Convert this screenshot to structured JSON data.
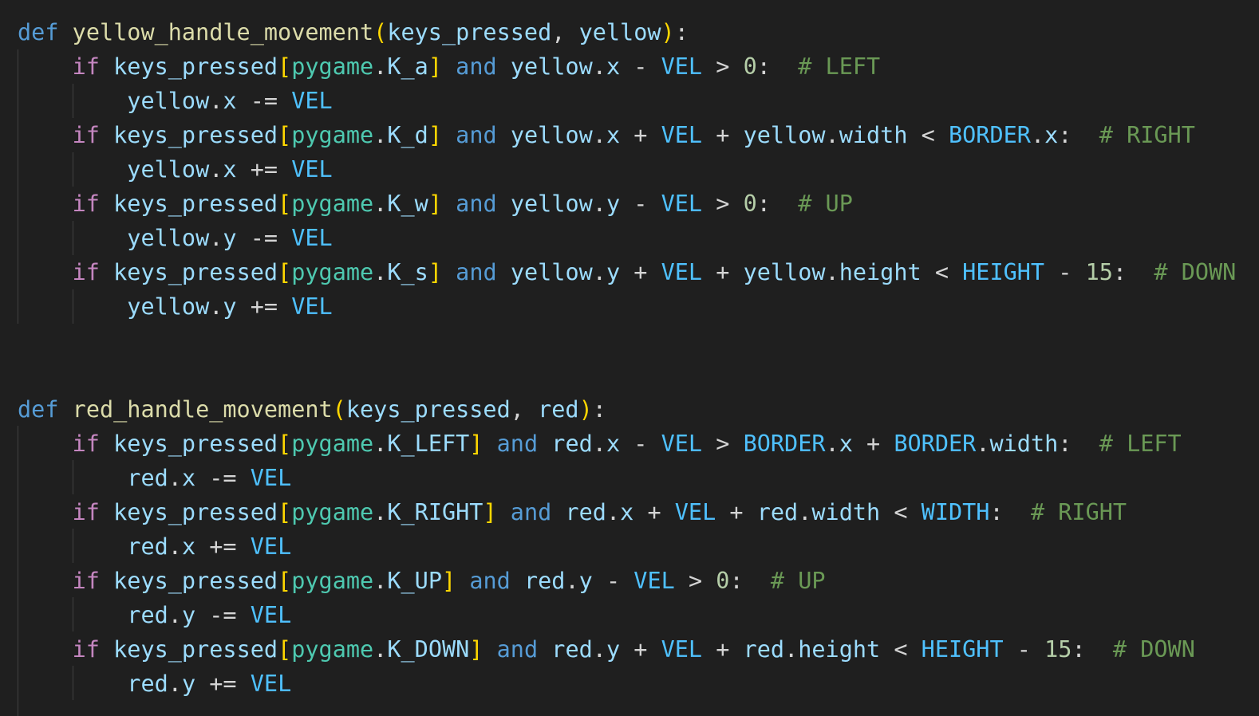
{
  "editor": {
    "lines": [
      [
        [
          "kw",
          "def"
        ],
        [
          "op",
          " "
        ],
        [
          "fn",
          "yellow_handle_movement"
        ],
        [
          "br",
          "("
        ],
        [
          "param",
          "keys_pressed"
        ],
        [
          "op",
          ", "
        ],
        [
          "param",
          "yellow"
        ],
        [
          "br",
          ")"
        ],
        [
          "op",
          ":"
        ]
      ],
      [
        [
          "op",
          "    "
        ],
        [
          "ctrl",
          "if"
        ],
        [
          "op",
          " "
        ],
        [
          "param",
          "keys_pressed"
        ],
        [
          "br",
          "["
        ],
        [
          "mod",
          "pygame"
        ],
        [
          "op",
          "."
        ],
        [
          "param",
          "K_a"
        ],
        [
          "br",
          "]"
        ],
        [
          "op",
          " "
        ],
        [
          "kw",
          "and"
        ],
        [
          "op",
          " "
        ],
        [
          "param",
          "yellow"
        ],
        [
          "op",
          "."
        ],
        [
          "param",
          "x"
        ],
        [
          "op",
          " - "
        ],
        [
          "const",
          "VEL"
        ],
        [
          "op",
          " > "
        ],
        [
          "num",
          "0"
        ],
        [
          "op",
          ":  "
        ],
        [
          "cmt",
          "# LEFT"
        ]
      ],
      [
        [
          "op",
          "        "
        ],
        [
          "param",
          "yellow"
        ],
        [
          "op",
          "."
        ],
        [
          "param",
          "x"
        ],
        [
          "op",
          " -= "
        ],
        [
          "const",
          "VEL"
        ]
      ],
      [
        [
          "op",
          "    "
        ],
        [
          "ctrl",
          "if"
        ],
        [
          "op",
          " "
        ],
        [
          "param",
          "keys_pressed"
        ],
        [
          "br",
          "["
        ],
        [
          "mod",
          "pygame"
        ],
        [
          "op",
          "."
        ],
        [
          "param",
          "K_d"
        ],
        [
          "br",
          "]"
        ],
        [
          "op",
          " "
        ],
        [
          "kw",
          "and"
        ],
        [
          "op",
          " "
        ],
        [
          "param",
          "yellow"
        ],
        [
          "op",
          "."
        ],
        [
          "param",
          "x"
        ],
        [
          "op",
          " + "
        ],
        [
          "const",
          "VEL"
        ],
        [
          "op",
          " + "
        ],
        [
          "param",
          "yellow"
        ],
        [
          "op",
          "."
        ],
        [
          "param",
          "width"
        ],
        [
          "op",
          " < "
        ],
        [
          "const",
          "BORDER"
        ],
        [
          "op",
          "."
        ],
        [
          "param",
          "x"
        ],
        [
          "op",
          ":  "
        ],
        [
          "cmt",
          "# RIGHT"
        ]
      ],
      [
        [
          "op",
          "        "
        ],
        [
          "param",
          "yellow"
        ],
        [
          "op",
          "."
        ],
        [
          "param",
          "x"
        ],
        [
          "op",
          " += "
        ],
        [
          "const",
          "VEL"
        ]
      ],
      [
        [
          "op",
          "    "
        ],
        [
          "ctrl",
          "if"
        ],
        [
          "op",
          " "
        ],
        [
          "param",
          "keys_pressed"
        ],
        [
          "br",
          "["
        ],
        [
          "mod",
          "pygame"
        ],
        [
          "op",
          "."
        ],
        [
          "param",
          "K_w"
        ],
        [
          "br",
          "]"
        ],
        [
          "op",
          " "
        ],
        [
          "kw",
          "and"
        ],
        [
          "op",
          " "
        ],
        [
          "param",
          "yellow"
        ],
        [
          "op",
          "."
        ],
        [
          "param",
          "y"
        ],
        [
          "op",
          " - "
        ],
        [
          "const",
          "VEL"
        ],
        [
          "op",
          " > "
        ],
        [
          "num",
          "0"
        ],
        [
          "op",
          ":  "
        ],
        [
          "cmt",
          "# UP"
        ]
      ],
      [
        [
          "op",
          "        "
        ],
        [
          "param",
          "yellow"
        ],
        [
          "op",
          "."
        ],
        [
          "param",
          "y"
        ],
        [
          "op",
          " -= "
        ],
        [
          "const",
          "VEL"
        ]
      ],
      [
        [
          "op",
          "    "
        ],
        [
          "ctrl",
          "if"
        ],
        [
          "op",
          " "
        ],
        [
          "param",
          "keys_pressed"
        ],
        [
          "br",
          "["
        ],
        [
          "mod",
          "pygame"
        ],
        [
          "op",
          "."
        ],
        [
          "param",
          "K_s"
        ],
        [
          "br",
          "]"
        ],
        [
          "op",
          " "
        ],
        [
          "kw",
          "and"
        ],
        [
          "op",
          " "
        ],
        [
          "param",
          "yellow"
        ],
        [
          "op",
          "."
        ],
        [
          "param",
          "y"
        ],
        [
          "op",
          " + "
        ],
        [
          "const",
          "VEL"
        ],
        [
          "op",
          " + "
        ],
        [
          "param",
          "yellow"
        ],
        [
          "op",
          "."
        ],
        [
          "param",
          "height"
        ],
        [
          "op",
          " < "
        ],
        [
          "const",
          "HEIGHT"
        ],
        [
          "op",
          " - "
        ],
        [
          "num",
          "15"
        ],
        [
          "op",
          ":  "
        ],
        [
          "cmt",
          "# DOWN"
        ]
      ],
      [
        [
          "op",
          "        "
        ],
        [
          "param",
          "yellow"
        ],
        [
          "op",
          "."
        ],
        [
          "param",
          "y"
        ],
        [
          "op",
          " += "
        ],
        [
          "const",
          "VEL"
        ]
      ],
      [],
      [],
      [
        [
          "kw",
          "def"
        ],
        [
          "op",
          " "
        ],
        [
          "fn",
          "red_handle_movement"
        ],
        [
          "br",
          "("
        ],
        [
          "param",
          "keys_pressed"
        ],
        [
          "op",
          ", "
        ],
        [
          "param",
          "red"
        ],
        [
          "br",
          ")"
        ],
        [
          "op",
          ":"
        ]
      ],
      [
        [
          "op",
          "    "
        ],
        [
          "ctrl",
          "if"
        ],
        [
          "op",
          " "
        ],
        [
          "param",
          "keys_pressed"
        ],
        [
          "br",
          "["
        ],
        [
          "mod",
          "pygame"
        ],
        [
          "op",
          "."
        ],
        [
          "param",
          "K_LEFT"
        ],
        [
          "br",
          "]"
        ],
        [
          "op",
          " "
        ],
        [
          "kw",
          "and"
        ],
        [
          "op",
          " "
        ],
        [
          "param",
          "red"
        ],
        [
          "op",
          "."
        ],
        [
          "param",
          "x"
        ],
        [
          "op",
          " - "
        ],
        [
          "const",
          "VEL"
        ],
        [
          "op",
          " > "
        ],
        [
          "const",
          "BORDER"
        ],
        [
          "op",
          "."
        ],
        [
          "param",
          "x"
        ],
        [
          "op",
          " + "
        ],
        [
          "const",
          "BORDER"
        ],
        [
          "op",
          "."
        ],
        [
          "param",
          "width"
        ],
        [
          "op",
          ":  "
        ],
        [
          "cmt",
          "# LEFT"
        ]
      ],
      [
        [
          "op",
          "        "
        ],
        [
          "param",
          "red"
        ],
        [
          "op",
          "."
        ],
        [
          "param",
          "x"
        ],
        [
          "op",
          " -= "
        ],
        [
          "const",
          "VEL"
        ]
      ],
      [
        [
          "op",
          "    "
        ],
        [
          "ctrl",
          "if"
        ],
        [
          "op",
          " "
        ],
        [
          "param",
          "keys_pressed"
        ],
        [
          "br",
          "["
        ],
        [
          "mod",
          "pygame"
        ],
        [
          "op",
          "."
        ],
        [
          "param",
          "K_RIGHT"
        ],
        [
          "br",
          "]"
        ],
        [
          "op",
          " "
        ],
        [
          "kw",
          "and"
        ],
        [
          "op",
          " "
        ],
        [
          "param",
          "red"
        ],
        [
          "op",
          "."
        ],
        [
          "param",
          "x"
        ],
        [
          "op",
          " + "
        ],
        [
          "const",
          "VEL"
        ],
        [
          "op",
          " + "
        ],
        [
          "param",
          "red"
        ],
        [
          "op",
          "."
        ],
        [
          "param",
          "width"
        ],
        [
          "op",
          " < "
        ],
        [
          "const",
          "WIDTH"
        ],
        [
          "op",
          ":  "
        ],
        [
          "cmt",
          "# RIGHT"
        ]
      ],
      [
        [
          "op",
          "        "
        ],
        [
          "param",
          "red"
        ],
        [
          "op",
          "."
        ],
        [
          "param",
          "x"
        ],
        [
          "op",
          " += "
        ],
        [
          "const",
          "VEL"
        ]
      ],
      [
        [
          "op",
          "    "
        ],
        [
          "ctrl",
          "if"
        ],
        [
          "op",
          " "
        ],
        [
          "param",
          "keys_pressed"
        ],
        [
          "br",
          "["
        ],
        [
          "mod",
          "pygame"
        ],
        [
          "op",
          "."
        ],
        [
          "param",
          "K_UP"
        ],
        [
          "br",
          "]"
        ],
        [
          "op",
          " "
        ],
        [
          "kw",
          "and"
        ],
        [
          "op",
          " "
        ],
        [
          "param",
          "red"
        ],
        [
          "op",
          "."
        ],
        [
          "param",
          "y"
        ],
        [
          "op",
          " - "
        ],
        [
          "const",
          "VEL"
        ],
        [
          "op",
          " > "
        ],
        [
          "num",
          "0"
        ],
        [
          "op",
          ":  "
        ],
        [
          "cmt",
          "# UP"
        ]
      ],
      [
        [
          "op",
          "        "
        ],
        [
          "param",
          "red"
        ],
        [
          "op",
          "."
        ],
        [
          "param",
          "y"
        ],
        [
          "op",
          " -= "
        ],
        [
          "const",
          "VEL"
        ]
      ],
      [
        [
          "op",
          "    "
        ],
        [
          "ctrl",
          "if"
        ],
        [
          "op",
          " "
        ],
        [
          "param",
          "keys_pressed"
        ],
        [
          "br",
          "["
        ],
        [
          "mod",
          "pygame"
        ],
        [
          "op",
          "."
        ],
        [
          "param",
          "K_DOWN"
        ],
        [
          "br",
          "]"
        ],
        [
          "op",
          " "
        ],
        [
          "kw",
          "and"
        ],
        [
          "op",
          " "
        ],
        [
          "param",
          "red"
        ],
        [
          "op",
          "."
        ],
        [
          "param",
          "y"
        ],
        [
          "op",
          " + "
        ],
        [
          "const",
          "VEL"
        ],
        [
          "op",
          " + "
        ],
        [
          "param",
          "red"
        ],
        [
          "op",
          "."
        ],
        [
          "param",
          "height"
        ],
        [
          "op",
          " < "
        ],
        [
          "const",
          "HEIGHT"
        ],
        [
          "op",
          " - "
        ],
        [
          "num",
          "15"
        ],
        [
          "op",
          ":  "
        ],
        [
          "cmt",
          "# DOWN"
        ]
      ],
      [
        [
          "op",
          "        "
        ],
        [
          "param",
          "red"
        ],
        [
          "op",
          "."
        ],
        [
          "param",
          "y"
        ],
        [
          "op",
          " += "
        ],
        [
          "const",
          "VEL"
        ]
      ]
    ]
  }
}
